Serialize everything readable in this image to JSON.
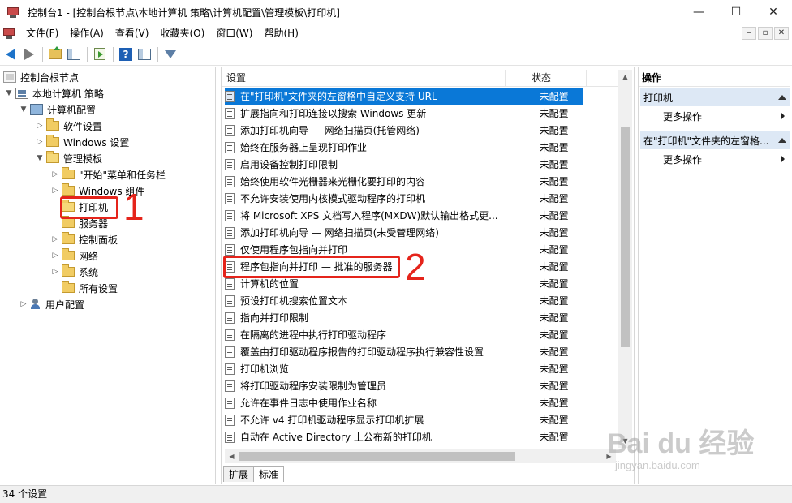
{
  "window": {
    "title": "控制台1 - [控制台根节点\\本地计算机 策略\\计算机配置\\管理模板\\打印机]",
    "minimize": "—",
    "maximize": "☐",
    "close": "✕"
  },
  "menu": {
    "items": [
      "文件(F)",
      "操作(A)",
      "查看(V)",
      "收藏夹(O)",
      "窗口(W)",
      "帮助(H)"
    ],
    "mdi": [
      "–",
      "▫",
      "✕"
    ]
  },
  "toolbar": {
    "icons": [
      "back-icon",
      "forward-icon",
      "up-folder-icon",
      "show-hide-tree-icon",
      "export-list-icon",
      "help-icon",
      "show-hide-action-pane-icon",
      "filter-icon"
    ],
    "help_glyph": "?"
  },
  "tree": {
    "items": [
      {
        "label": "控制台根节点",
        "level": 0
      },
      {
        "label": "本地计算机 策略",
        "level": 1
      },
      {
        "label": "计算机配置",
        "level": 2
      },
      {
        "label": "软件设置",
        "level": 3
      },
      {
        "label": "Windows 设置",
        "level": 3
      },
      {
        "label": "管理模板",
        "level": 3
      },
      {
        "label": "\"开始\"菜单和任务栏",
        "level": 4
      },
      {
        "label": "Windows 组件",
        "level": 4
      },
      {
        "label": "打印机",
        "level": 4
      },
      {
        "label": "服务器",
        "level": 4
      },
      {
        "label": "控制面板",
        "level": 4
      },
      {
        "label": "网络",
        "level": 4
      },
      {
        "label": "系统",
        "level": 4
      },
      {
        "label": "所有设置",
        "level": 4
      },
      {
        "label": "用户配置",
        "level": 2
      }
    ]
  },
  "annotations": {
    "marker_1": "1",
    "marker_2": "2",
    "color": "#e5241b"
  },
  "list": {
    "headers": {
      "setting": "设置",
      "state": "状态"
    },
    "rows": [
      {
        "name": "在\"打印机\"文件夹的左窗格中自定义支持 URL",
        "state": "未配置",
        "selected": true
      },
      {
        "name": "扩展指向和打印连接以搜索 Windows 更新",
        "state": "未配置"
      },
      {
        "name": "添加打印机向导 — 网络扫描页(托管网络)",
        "state": "未配置"
      },
      {
        "name": "始终在服务器上呈现打印作业",
        "state": "未配置"
      },
      {
        "name": "启用设备控制打印限制",
        "state": "未配置"
      },
      {
        "name": "始终使用软件光栅器来光栅化要打印的内容",
        "state": "未配置"
      },
      {
        "name": "不允许安装使用内核模式驱动程序的打印机",
        "state": "未配置"
      },
      {
        "name": "将 Microsoft XPS 文档写入程序(MXDW)默认输出格式更...",
        "state": "未配置"
      },
      {
        "name": "添加打印机向导 — 网络扫描页(未受管理网络)",
        "state": "未配置"
      },
      {
        "name": "仅使用程序包指向并打印",
        "state": "未配置"
      },
      {
        "name": "程序包指向并打印 — 批准的服务器",
        "state": "未配置"
      },
      {
        "name": "计算机的位置",
        "state": "未配置"
      },
      {
        "name": "预设打印机搜索位置文本",
        "state": "未配置"
      },
      {
        "name": "指向并打印限制",
        "state": "未配置"
      },
      {
        "name": "在隔离的进程中执行打印驱动程序",
        "state": "未配置"
      },
      {
        "name": "覆盖由打印驱动程序报告的打印驱动程序执行兼容性设置",
        "state": "未配置"
      },
      {
        "name": "打印机浏览",
        "state": "未配置"
      },
      {
        "name": "将打印驱动程序安装限制为管理员",
        "state": "未配置"
      },
      {
        "name": "允许在事件日志中使用作业名称",
        "state": "未配置"
      },
      {
        "name": "不允许 v4 打印机驱动程序显示打印机扩展",
        "state": "未配置"
      },
      {
        "name": "自动在 Active Directory 上公布新的打印机",
        "state": "未配置"
      }
    ],
    "tabs": [
      "扩展",
      "标准"
    ],
    "active_tab": "标准"
  },
  "actions": {
    "title": "操作",
    "groups": [
      {
        "label": "打印机",
        "item": "更多操作"
      },
      {
        "label": "在\"打印机\"文件夹的左窗格...",
        "item": "更多操作"
      }
    ]
  },
  "status": {
    "text": "34 个设置"
  },
  "watermark": {
    "main": "Bai du 经验",
    "sub": "jingyan.baidu.com"
  },
  "colors": {
    "selection": "#0a78d7",
    "action_group": "#dde8f5"
  }
}
